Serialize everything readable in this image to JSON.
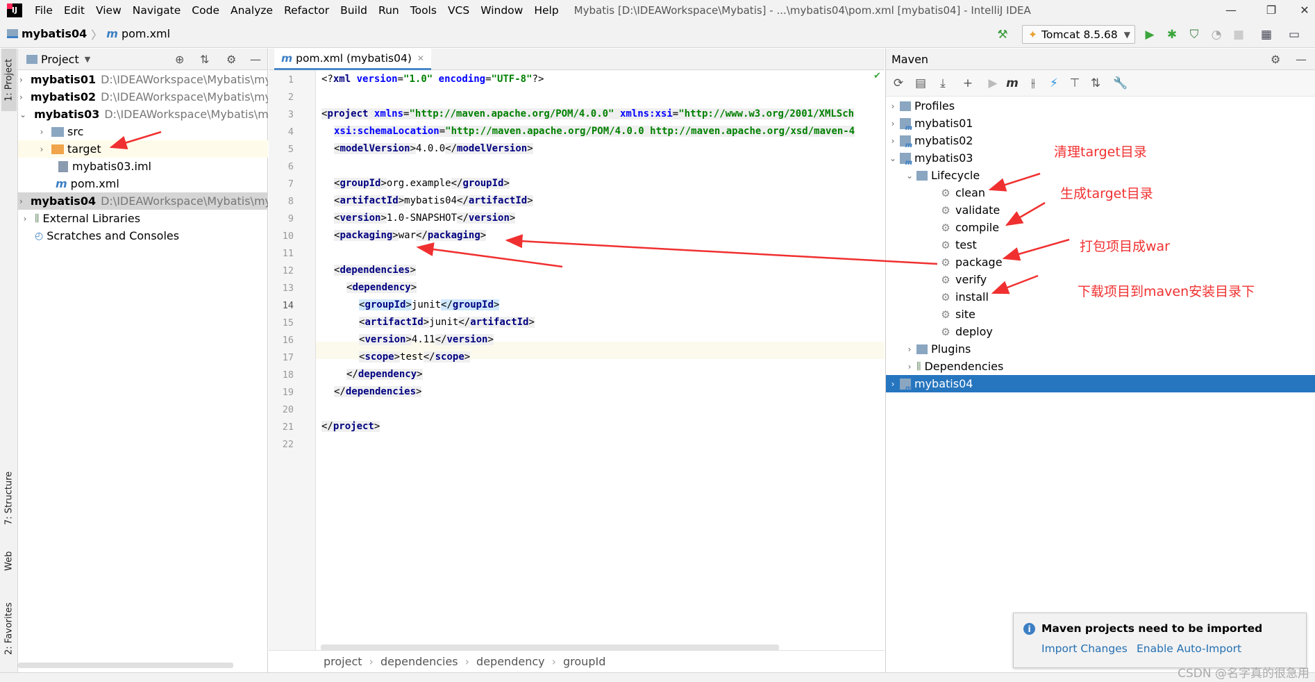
{
  "window": {
    "app_logo": "IJ",
    "title": "Mybatis [D:\\IDEAWorkspace\\Mybatis] - ...\\mybatis04\\pom.xml [mybatis04] - IntelliJ IDEA",
    "minimize": "—",
    "restore": "❐",
    "close": "✕"
  },
  "menu": [
    "File",
    "Edit",
    "View",
    "Navigate",
    "Code",
    "Analyze",
    "Refactor",
    "Build",
    "Run",
    "Tools",
    "VCS",
    "Window",
    "Help"
  ],
  "navbar": {
    "project": "mybatis04",
    "file": "pom.xml",
    "run_config": "Tomcat 8.5.68"
  },
  "side_tabs": {
    "project": "1: Project",
    "structure": "7: Structure",
    "web": "Web",
    "favorites": "2: Favorites"
  },
  "project_panel": {
    "title": "Project",
    "items": [
      {
        "name": "mybatis01",
        "path": "D:\\IDEAWorkspace\\Mybatis\\my",
        "bold": true
      },
      {
        "name": "mybatis02",
        "path": "D:\\IDEAWorkspace\\Mybatis\\my",
        "bold": true
      },
      {
        "name": "mybatis03",
        "path": "D:\\IDEAWorkspace\\Mybatis\\my",
        "bold": true
      },
      {
        "name": "src"
      },
      {
        "name": "target"
      },
      {
        "name": "mybatis03.iml"
      },
      {
        "name": "pom.xml"
      },
      {
        "name": "mybatis04",
        "path": "D:\\IDEAWorkspace\\Mybatis\\my",
        "bold": true
      },
      {
        "name": "External Libraries"
      },
      {
        "name": "Scratches and Consoles"
      }
    ]
  },
  "editor": {
    "tab": "pom.xml (mybatis04)",
    "line_numbers": [
      "1",
      "2",
      "3",
      "4",
      "5",
      "6",
      "7",
      "8",
      "9",
      "10",
      "11",
      "12",
      "13",
      "14",
      "15",
      "16",
      "17",
      "18",
      "19",
      "20",
      "21",
      "22"
    ],
    "breadcrumb": [
      "project",
      "dependencies",
      "dependency",
      "groupId"
    ]
  },
  "maven": {
    "title": "Maven",
    "rows": {
      "profiles": "Profiles",
      "m1": "mybatis01",
      "m2": "mybatis02",
      "m3": "mybatis03",
      "lifecycle": "Lifecycle",
      "clean": "clean",
      "validate": "validate",
      "compile": "compile",
      "test": "test",
      "package": "package",
      "verify": "verify",
      "install": "install",
      "site": "site",
      "deploy": "deploy",
      "plugins": "Plugins",
      "dependencies": "Dependencies",
      "m4": "mybatis04"
    }
  },
  "annotations": {
    "clean": "清理target目录",
    "compile": "生成target目录",
    "package": "打包项目成war",
    "install": "下载项目到maven安装目录下"
  },
  "notification": {
    "icon": "i",
    "title": "Maven projects need to be imported",
    "import": "Import Changes",
    "auto": "Enable Auto-Import"
  },
  "watermark": "CSDN @名字真的很急用"
}
